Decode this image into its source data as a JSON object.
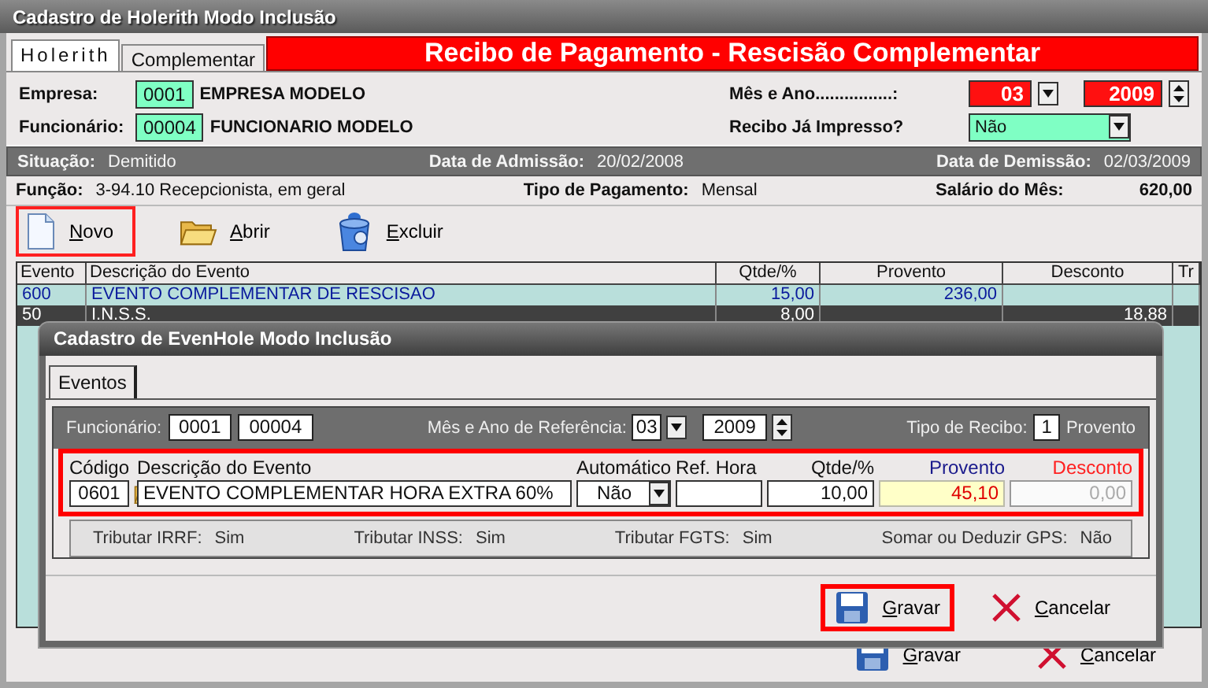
{
  "window": {
    "title": "Cadastro de Holerith Modo Inclusão"
  },
  "tabs": [
    {
      "label": "Holerith",
      "selected": true
    },
    {
      "label": "Complementar",
      "selected": false
    }
  ],
  "banner": "Recibo de Pagamento - Rescisão Complementar",
  "empresa": {
    "label": "Empresa:",
    "code": "0001",
    "name": "EMPRESA MODELO"
  },
  "funcionario": {
    "label": "Funcionário:",
    "code": "00004",
    "name": "FUNCIONARIO MODELO"
  },
  "mes_ano": {
    "label": "Mês e Ano................:",
    "month": "03",
    "year": "2009"
  },
  "recibo_impresso": {
    "label": "Recibo Já Impresso?",
    "value": "Não"
  },
  "status_bar": [
    {
      "label": "Situação:",
      "value": "Demitido"
    },
    {
      "label": "Data de Admissão:",
      "value": "20/02/2008"
    },
    {
      "label": "Data de Demissão:",
      "value": "02/03/2009"
    }
  ],
  "info_row": [
    {
      "label": "Função:",
      "value": "3-94.10  Recepcionista, em geral"
    },
    {
      "label": "Tipo de Pagamento:",
      "value": "Mensal"
    },
    {
      "label": "Salário do Mês:",
      "value": "620,00"
    }
  ],
  "toolbar": [
    {
      "label": "Novo",
      "highlighted": true
    },
    {
      "label": "Abrir",
      "highlighted": false
    },
    {
      "label": "Excluir",
      "highlighted": false
    }
  ],
  "table": {
    "columns": [
      "Evento",
      "Descrição do Evento",
      "Qtde/%",
      "Provento",
      "Desconto",
      "Tr"
    ],
    "rows": [
      {
        "evento": "600",
        "descricao": "EVENTO COMPLEMENTAR DE RESCISAO",
        "qtde": "15,00",
        "provento": "236,00",
        "selected": false
      },
      {
        "evento": "50",
        "descricao": "I.N.S.S.",
        "qtde": "8,00",
        "desconto": "18,88",
        "selected": true
      }
    ]
  },
  "footer_buttons": [
    {
      "label": "Gravar"
    },
    {
      "label": "Cancelar"
    }
  ],
  "dialog": {
    "title": "Cadastro de EvenHole Modo Inclusão",
    "tabs": [
      {
        "label": "Eventos",
        "selected": true
      }
    ],
    "header": {
      "funcionario_label": "Funcionário:",
      "empresa_code": "0001",
      "funcionario_code": "00004",
      "ref_label": "Mês e Ano de Referência:",
      "month": "03",
      "year": "2009",
      "tipo_label": "Tipo de Recibo:",
      "tipo_code": "1",
      "tipo_name": "Provento"
    },
    "fields": [
      {
        "kind": "picker",
        "label": "Código",
        "value": "0601",
        "highlighted": false,
        "disabled": false
      },
      {
        "kind": "text",
        "label": "Descrição do Evento",
        "value": "EVENTO COMPLEMENTAR HORA EXTRA 60%",
        "highlighted": false,
        "disabled": false
      },
      {
        "kind": "select",
        "label": "Automático",
        "value": "Não",
        "highlighted": false,
        "disabled": false
      },
      {
        "kind": "text",
        "label": "Ref. Hora",
        "highlighted": false,
        "disabled": false
      },
      {
        "kind": "number",
        "label": "Qtde/%",
        "value": "10,00",
        "highlighted": false,
        "disabled": false
      },
      {
        "kind": "number",
        "label": "Provento",
        "value": "45,10",
        "color": "#1a1a8c",
        "highlighted": true,
        "disabled": false
      },
      {
        "kind": "number",
        "label": "Desconto",
        "value": "0,00",
        "color": "#ff2020",
        "highlighted": false,
        "disabled": true
      }
    ],
    "flags": [
      {
        "label": "Tributar IRRF:",
        "value": "Sim"
      },
      {
        "label": "Tributar INSS:",
        "value": "Sim"
      },
      {
        "label": "Tributar FGTS:",
        "value": "Sim"
      },
      {
        "label": "Somar ou Deduzir GPS:",
        "value": "Não"
      }
    ],
    "buttons": [
      {
        "kind": "save",
        "label": "Gravar",
        "highlighted": true
      },
      {
        "kind": "cancel",
        "label": "Cancelar",
        "highlighted": false
      }
    ]
  }
}
